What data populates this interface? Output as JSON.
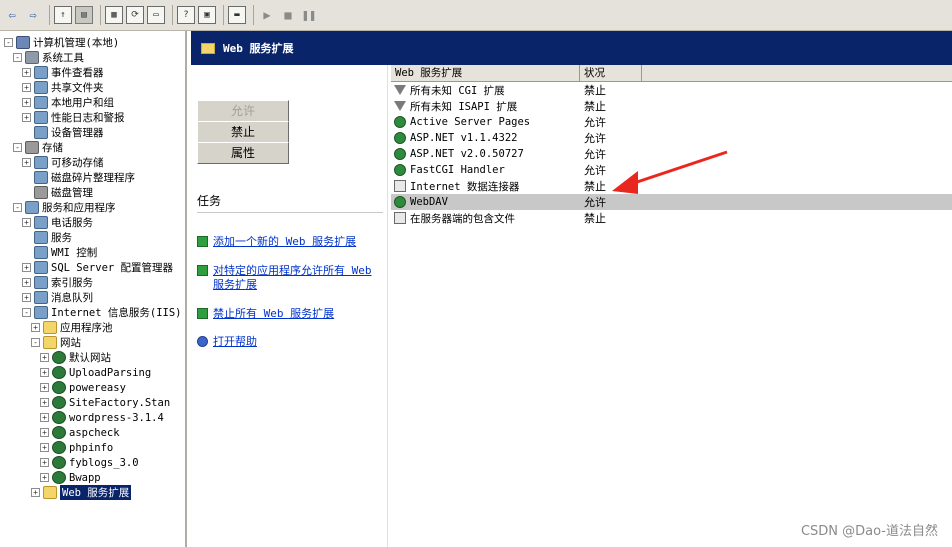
{
  "tree": [
    {
      "label": "计算机管理(本地)",
      "icon": "computer-icon",
      "level": 0,
      "exp": "-"
    },
    {
      "label": "系统工具",
      "icon": "tools-icon",
      "level": 1,
      "exp": "-"
    },
    {
      "label": "事件查看器",
      "icon": "event-viewer-icon",
      "level": 2,
      "exp": "+"
    },
    {
      "label": "共享文件夹",
      "icon": "shared-folder-icon",
      "level": 2,
      "exp": "+"
    },
    {
      "label": "本地用户和组",
      "icon": "users-icon",
      "level": 2,
      "exp": "+"
    },
    {
      "label": "性能日志和警报",
      "icon": "performance-icon",
      "level": 2,
      "exp": "+"
    },
    {
      "label": "设备管理器",
      "icon": "device-manager-icon",
      "level": 2,
      "exp": ""
    },
    {
      "label": "存储",
      "icon": "storage-icon",
      "level": 1,
      "exp": "-"
    },
    {
      "label": "可移动存储",
      "icon": "removable-storage-icon",
      "level": 2,
      "exp": "+"
    },
    {
      "label": "磁盘碎片整理程序",
      "icon": "defrag-icon",
      "level": 2,
      "exp": ""
    },
    {
      "label": "磁盘管理",
      "icon": "disk-icon",
      "level": 2,
      "exp": ""
    },
    {
      "label": "服务和应用程序",
      "icon": "services-apps-icon",
      "level": 1,
      "exp": "-"
    },
    {
      "label": "电话服务",
      "icon": "telephony-icon",
      "level": 2,
      "exp": "+"
    },
    {
      "label": "服务",
      "icon": "services-icon",
      "level": 2,
      "exp": ""
    },
    {
      "label": "WMI 控制",
      "icon": "wmi-icon",
      "level": 2,
      "exp": ""
    },
    {
      "label": "SQL Server 配置管理器",
      "icon": "sql-icon",
      "level": 2,
      "exp": "+"
    },
    {
      "label": "索引服务",
      "icon": "index-icon",
      "level": 2,
      "exp": "+"
    },
    {
      "label": "消息队列",
      "icon": "message-queue-icon",
      "level": 2,
      "exp": "+"
    },
    {
      "label": "Internet 信息服务(IIS)",
      "icon": "iis-icon",
      "level": 2,
      "exp": "-"
    },
    {
      "label": "应用程序池",
      "icon": "folder-icon",
      "level": 3,
      "exp": "+"
    },
    {
      "label": "网站",
      "icon": "folder-icon",
      "level": 3,
      "exp": "-"
    },
    {
      "label": "默认网站",
      "icon": "globe-icon",
      "level": 4,
      "exp": "+"
    },
    {
      "label": "UploadParsing",
      "icon": "globe-icon",
      "level": 4,
      "exp": "+"
    },
    {
      "label": "powereasy",
      "icon": "globe-icon",
      "level": 4,
      "exp": "+"
    },
    {
      "label": "SiteFactory.Stan",
      "icon": "globe-icon",
      "level": 4,
      "exp": "+"
    },
    {
      "label": "wordpress-3.1.4",
      "icon": "globe-icon",
      "level": 4,
      "exp": "+"
    },
    {
      "label": "aspcheck",
      "icon": "globe-icon",
      "level": 4,
      "exp": "+"
    },
    {
      "label": "phpinfo",
      "icon": "globe-icon",
      "level": 4,
      "exp": "+"
    },
    {
      "label": "fyblogs_3.0",
      "icon": "globe-icon",
      "level": 4,
      "exp": "+"
    },
    {
      "label": "Bwapp",
      "icon": "globe-icon",
      "level": 4,
      "exp": "+"
    },
    {
      "label": "Web 服务扩展",
      "icon": "folder-icon",
      "level": 3,
      "exp": "+",
      "selected": true
    }
  ],
  "header": {
    "title": "Web 服务扩展"
  },
  "buttons": {
    "allow": "允许",
    "deny": "禁止",
    "properties": "属性"
  },
  "tasks": {
    "title": "任务",
    "items": [
      {
        "label": "添加一个新的 Web 服务扩展",
        "icon": "add-icon"
      },
      {
        "label": "对特定的应用程序允许所有 Web 服务扩展",
        "icon": "allow-app-icon"
      },
      {
        "label": "禁止所有 Web 服务扩展",
        "icon": "deny-all-icon"
      },
      {
        "label": "打开帮助",
        "icon": "help-icon"
      }
    ]
  },
  "list": {
    "columns": [
      "Web 服务扩展",
      "状况"
    ],
    "rows": [
      {
        "name": "所有未知 CGI 扩展",
        "status": "禁止",
        "icon": "filter-icon"
      },
      {
        "name": "所有未知 ISAPI 扩展",
        "status": "禁止",
        "icon": "filter-icon"
      },
      {
        "name": "Active Server Pages",
        "status": "允许",
        "icon": "extension-icon"
      },
      {
        "name": "ASP.NET v1.1.4322",
        "status": "允许",
        "icon": "extension-icon"
      },
      {
        "name": "ASP.NET v2.0.50727",
        "status": "允许",
        "icon": "extension-icon"
      },
      {
        "name": "FastCGI Handler",
        "status": "允许",
        "icon": "extension-icon"
      },
      {
        "name": "Internet 数据连接器",
        "status": "禁止",
        "icon": "page-icon"
      },
      {
        "name": "WebDAV",
        "status": "允许",
        "icon": "extension-icon",
        "selected": true
      },
      {
        "name": "在服务器端的包含文件",
        "status": "禁止",
        "icon": "page-icon"
      }
    ]
  },
  "watermark": "CSDN @Dao-道法自然",
  "colors": {
    "header_bg": "#0a246a",
    "selection": "#0a246a",
    "arrow": "#e8281e",
    "link": "#0033cc"
  }
}
